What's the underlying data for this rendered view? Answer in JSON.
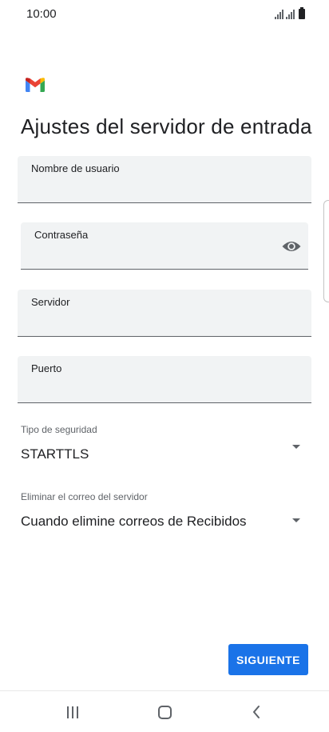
{
  "status_bar": {
    "time": "10:00",
    "icons": [
      "signal-icon",
      "signal-icon",
      "battery-icon"
    ]
  },
  "header": {
    "logo": "gmail-logo",
    "title": "Ajustes del servidor de entrada"
  },
  "fields": {
    "username": {
      "label": "Nombre de usuario",
      "value": ""
    },
    "password": {
      "label": "Contraseña",
      "value": "",
      "icon": "eye-icon"
    },
    "server": {
      "label": "Servidor",
      "value": ""
    },
    "port": {
      "label": "Puerto",
      "value": ""
    }
  },
  "selects": {
    "security": {
      "label": "Tipo de seguridad",
      "value": "STARTTLS"
    },
    "delete_mail": {
      "label": "Eliminar el correo del servidor",
      "value": "Cuando elimine correos de Recibidos"
    }
  },
  "actions": {
    "next_label": "SIGUIENTE"
  },
  "colors": {
    "accent": "#1a73e8",
    "field_background": "#f1f3f4",
    "text": "#202124",
    "secondary_text": "#5f6368"
  },
  "nav_bar": {
    "icons": [
      "recents-icon",
      "home-icon",
      "back-icon"
    ]
  }
}
